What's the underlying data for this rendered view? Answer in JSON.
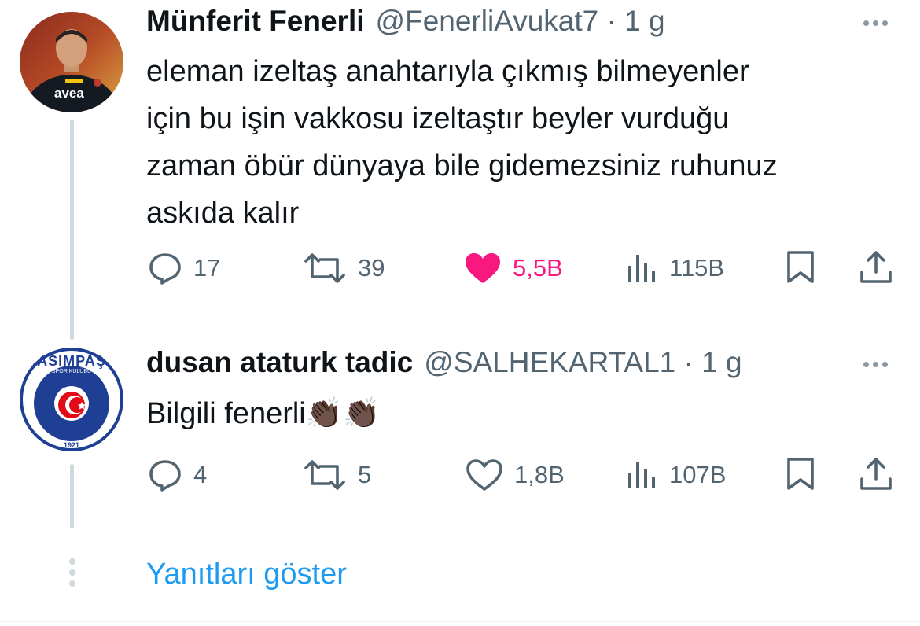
{
  "tweet1": {
    "display_name": "Münferit Fenerli",
    "meta": "@FenerliAvukat7 · 1 g",
    "text_lines": [
      "eleman izeltaş anahtarıyla çıkmış bilmeyenler",
      "için bu işin vakkosu izeltaştır beyler vurduğu",
      "zaman öbür dünyaya bile gidemezsiniz ruhunuz",
      "askıda kalır"
    ],
    "avatar_text": "avea",
    "actions": {
      "replies": "17",
      "retweets": "39",
      "likes": "5,5B",
      "views": "115B"
    },
    "liked": true
  },
  "tweet2": {
    "display_name": "dusan ataturk tadic",
    "meta": "@SALHEKARTAL1 · 1 g",
    "text": "Bilgili fenerli👏🏿👏🏿",
    "avatar_text": {
      "top": "KASIMPAŞA",
      "sub": "SPOR KULÜBÜ",
      "year": "1921"
    },
    "actions": {
      "replies": "4",
      "retweets": "5",
      "likes": "1,8B",
      "views": "107B"
    }
  },
  "show_replies_label": "Yanıtları göster",
  "colors": {
    "like_active": "#f91880",
    "link": "#1d9bf0",
    "muted": "#536471"
  },
  "icons": [
    "reply-icon",
    "retweet-icon",
    "like-icon",
    "views-icon",
    "bookmark-icon",
    "share-icon",
    "more-icon"
  ]
}
